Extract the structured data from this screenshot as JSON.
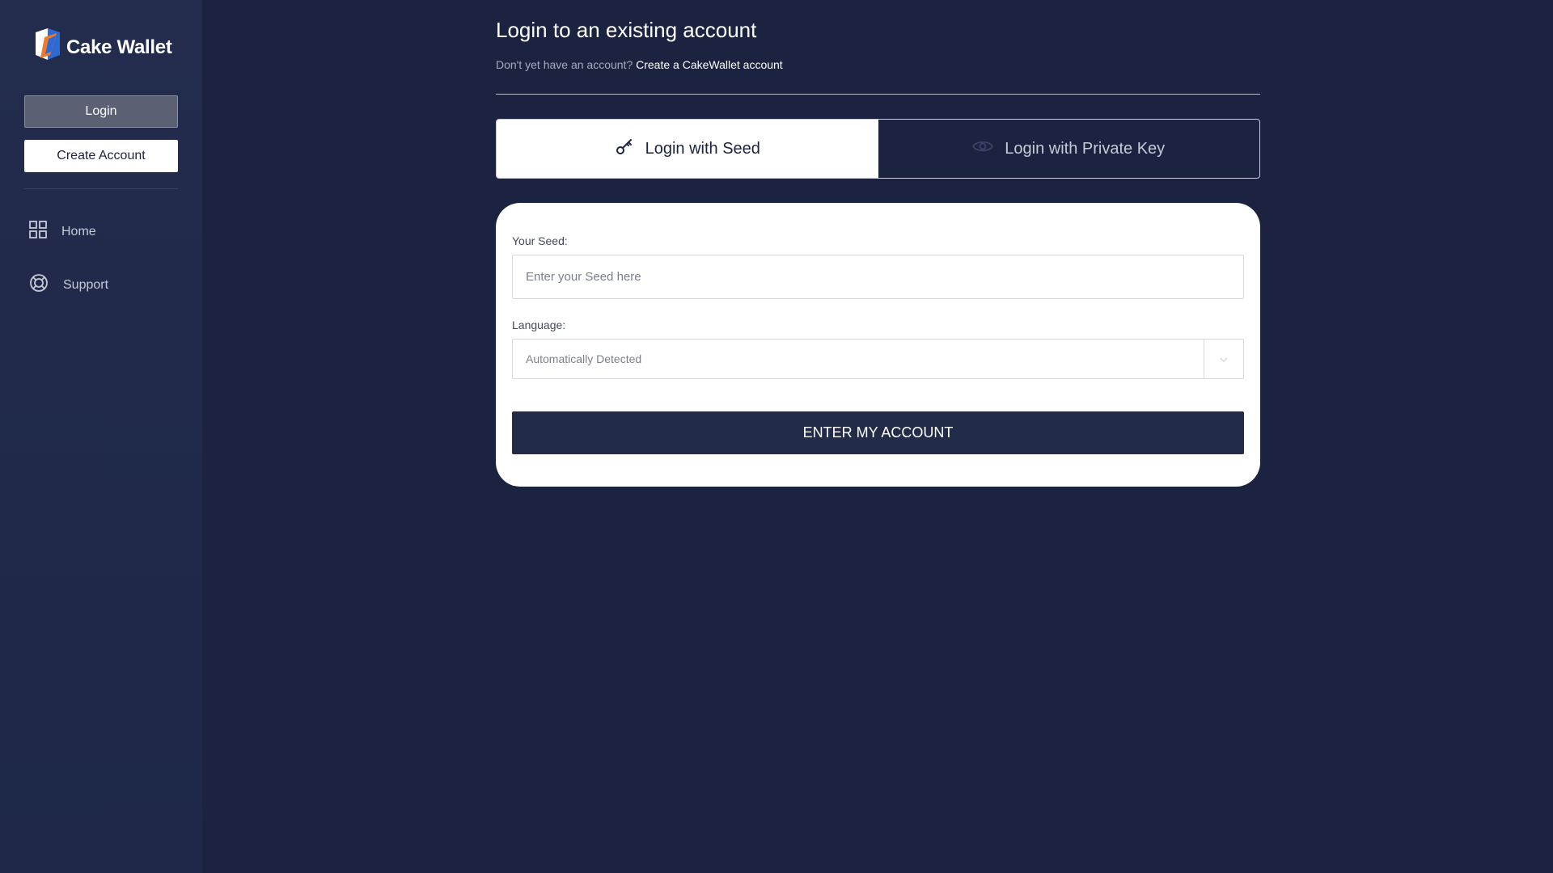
{
  "brand": {
    "name": "Cake Wallet",
    "logo_icon": "cake-wallet-logo"
  },
  "sidebar": {
    "login_label": "Login",
    "create_account_label": "Create Account",
    "nav": [
      {
        "label": "Home",
        "icon": "grid-icon"
      },
      {
        "label": "Support",
        "icon": "lifebuoy-icon"
      }
    ]
  },
  "main": {
    "title": "Login to an existing account",
    "subtitle_prefix": "Don't yet have an account?",
    "subtitle_link": "Create a CakeWallet account",
    "tabs": [
      {
        "label": "Login with Seed",
        "icon": "key-icon",
        "active": true
      },
      {
        "label": "Login with Private Key",
        "icon": "eye-icon",
        "active": false
      }
    ],
    "form": {
      "seed_label": "Your Seed:",
      "seed_placeholder": "Enter your Seed here",
      "seed_value": "",
      "language_label": "Language:",
      "language_value": "Automatically Detected",
      "submit_label": "ENTER MY ACCOUNT"
    }
  },
  "colors": {
    "background": "#1c2340",
    "sidebar": "#232c4d",
    "button_dark": "#222b48",
    "white": "#ffffff"
  }
}
